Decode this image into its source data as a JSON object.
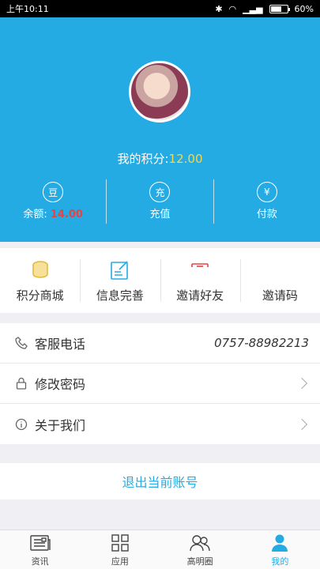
{
  "status_bar": {
    "time": "上午10:11",
    "battery": "60%"
  },
  "profile": {
    "points_label": "我的积分:",
    "points_value": "12.00"
  },
  "stats": [
    {
      "icon": "bean-icon",
      "icon_char": "豆",
      "label": "余额:",
      "value": "14.00"
    },
    {
      "icon": "recharge-icon",
      "icon_char": "充",
      "label": "充值"
    },
    {
      "icon": "payment-icon",
      "icon_char": "¥",
      "label": "付款"
    }
  ],
  "menu": [
    {
      "icon": "coins-icon",
      "label": "积分商城"
    },
    {
      "icon": "edit-info-icon",
      "label": "信息完善"
    },
    {
      "icon": "invite-icon",
      "label": "邀请好友"
    },
    {
      "icon": "invite-code-icon",
      "label": "邀请码"
    }
  ],
  "list": {
    "service": {
      "icon": "phone-icon",
      "label": "客服电话",
      "value": "0757-88982213"
    },
    "password": {
      "icon": "lock-icon",
      "label": "修改密码"
    },
    "about": {
      "icon": "info-icon",
      "label": "关于我们"
    }
  },
  "logout_label": "退出当前账号",
  "tabs": [
    {
      "icon": "news-icon",
      "label": "资讯"
    },
    {
      "icon": "apps-icon",
      "label": "应用"
    },
    {
      "icon": "community-icon",
      "label": "高明圈"
    },
    {
      "icon": "user-icon",
      "label": "我的",
      "active": true
    }
  ],
  "colors": {
    "brand": "#25abe4",
    "points": "#f3d84c",
    "balance": "#e84343"
  }
}
